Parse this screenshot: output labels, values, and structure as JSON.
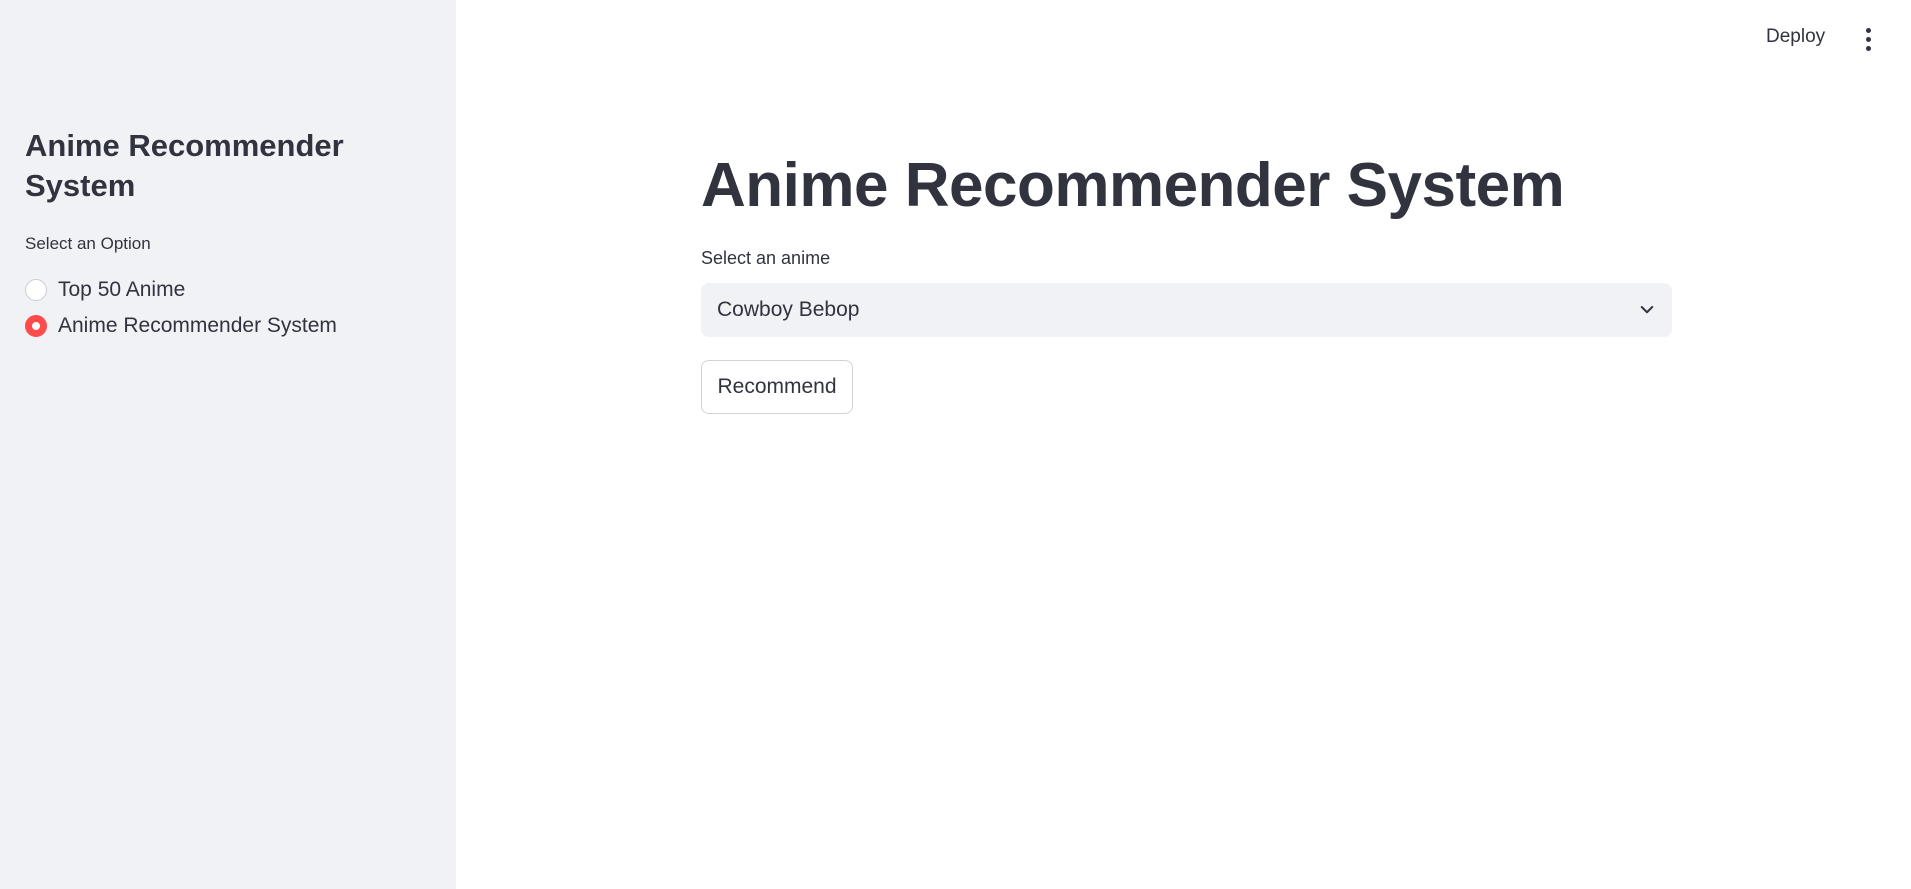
{
  "sidebar": {
    "title": "Anime Recommender System",
    "radio_label": "Select an Option",
    "options": [
      {
        "label": "Top 50 Anime",
        "selected": false
      },
      {
        "label": "Anime Recommender System",
        "selected": true
      }
    ]
  },
  "topbar": {
    "deploy_label": "Deploy",
    "menu_icon": "more-vertical-icon"
  },
  "main": {
    "title": "Anime Recommender System",
    "select": {
      "label": "Select an anime",
      "value": "Cowboy Bebop",
      "icon": "chevron-down-icon"
    },
    "button_label": "Recommend"
  },
  "colors": {
    "accent": "#ff4b4b",
    "sidebar_bg": "#f0f2f6",
    "text": "#31333f"
  }
}
